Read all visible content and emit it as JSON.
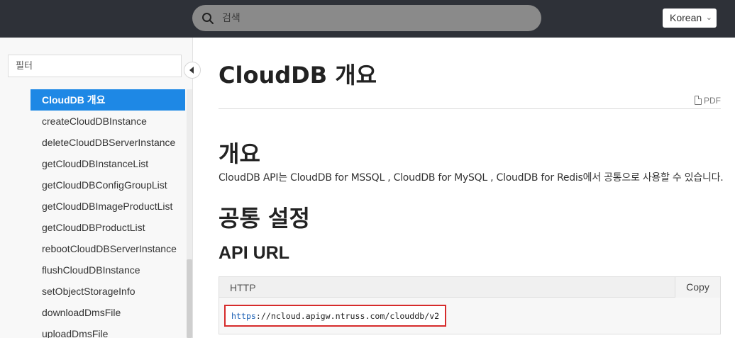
{
  "header": {
    "search_placeholder": "검색",
    "language": "Korean",
    "colors": {
      "bar": "#2e3138",
      "search_bg": "#8a8a8a"
    }
  },
  "sidebar": {
    "filter_placeholder": "필터",
    "items": [
      {
        "label": "CloudDB 개요",
        "active": true
      },
      {
        "label": "createCloudDBInstance"
      },
      {
        "label": "deleteCloudDBServerInstance"
      },
      {
        "label": "getCloudDBInstanceList"
      },
      {
        "label": "getCloudDBConfigGroupList"
      },
      {
        "label": "getCloudDBImageProductList"
      },
      {
        "label": "getCloudDBProductList"
      },
      {
        "label": "rebootCloudDBServerInstance"
      },
      {
        "label": "flushCloudDBInstance"
      },
      {
        "label": "setObjectStorageInfo"
      },
      {
        "label": "downloadDmsFile"
      },
      {
        "label": "uploadDmsFile"
      }
    ],
    "active_color": "#1e88e5"
  },
  "main": {
    "title": "CloudDB 개요",
    "pdf_label": "PDF",
    "overview_heading": "개요",
    "overview_text": "CloudDB API는 CloudDB for MSSQL , CloudDB for MySQL , CloudDB for Redis에서 공통으로 사용할 수 있습니다.",
    "common_heading": "공통 설정",
    "api_url_heading": "API URL",
    "code": {
      "language": "HTTP",
      "copy_label": "Copy",
      "url_scheme": "https",
      "url_rest": "://ncloud.apigw.ntruss.com/clouddb/v2",
      "highlight_color": "#d62b2b"
    }
  }
}
